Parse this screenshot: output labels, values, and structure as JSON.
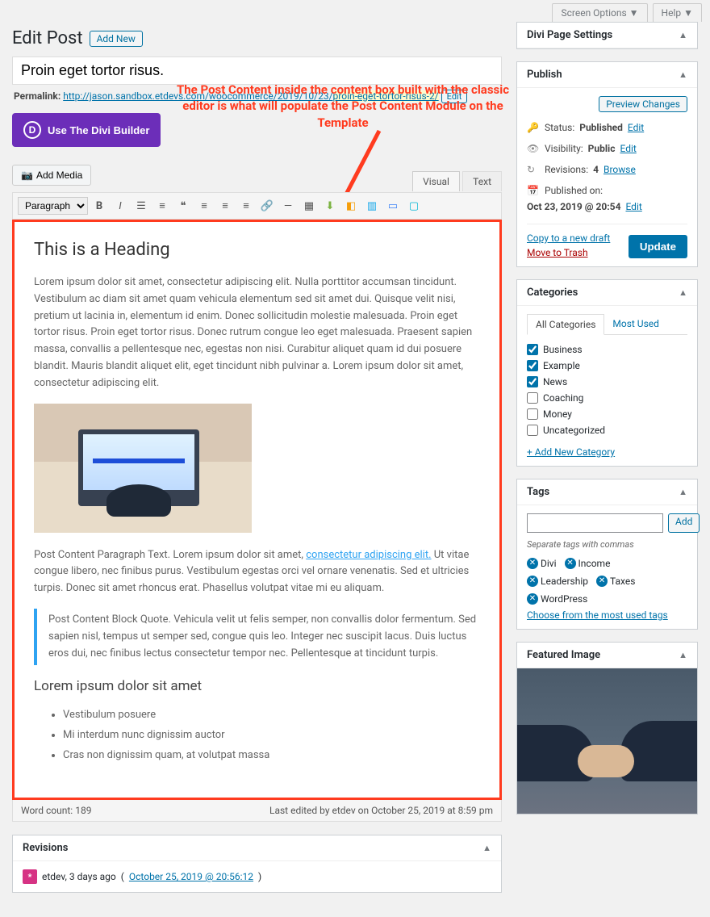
{
  "topbar": {
    "screen_options": "Screen Options",
    "help": "Help"
  },
  "heading": {
    "title": "Edit Post",
    "add_new": "Add New"
  },
  "title_field": {
    "value": "Proin eget tortor risus."
  },
  "permalink": {
    "label": "Permalink:",
    "base": "http://jason.sandbox.etdevs.com/woocommerce/2019/10/23/",
    "slug": "proin-eget-tortor-risus-2/",
    "edit": "Edit"
  },
  "divi_button": "Use The Divi Builder",
  "annotation_text": "The Post Content inside the content box built with the classic editor is what will populate the Post Content Module on the Template",
  "media_button": "Add Media",
  "editor_tabs": {
    "visual": "Visual",
    "text": "Text"
  },
  "toolbar": {
    "format": "Paragraph"
  },
  "post_content": {
    "heading": "This is a Heading",
    "para1": "Lorem ipsum dolor sit amet, consectetur adipiscing elit. Nulla porttitor accumsan tincidunt. Vestibulum ac diam sit amet quam vehicula elementum sed sit amet dui. Quisque velit nisi, pretium ut lacinia in, elementum id enim. Donec sollicitudin molestie malesuada. Proin eget tortor risus. Proin eget tortor risus. Donec rutrum congue leo eget malesuada. Praesent sapien massa, convallis a pellentesque nec, egestas non nisi. Curabitur aliquet quam id dui posuere blandit. Mauris blandit aliquet elit, eget tincidunt nibh pulvinar a. Lorem ipsum dolor sit amet, consectetur adipiscing elit.",
    "para2_before": "Post Content Paragraph Text. Lorem ipsum dolor sit amet, ",
    "para2_link": "consectetur adipiscing elit.",
    "para2_after": " Ut vitae congue libero, nec finibus purus. Vestibulum egestas orci vel ornare venenatis. Sed et ultricies turpis. Donec sit amet rhoncus erat. Phasellus volutpat vitae mi eu aliquam.",
    "quote": "Post Content Block Quote. Vehicula velit ut felis semper, non convallis dolor fermentum. Sed sapien nisl, tempus ut semper sed, congue quis leo. Integer nec suscipit lacus. Duis luctus eros dui, nec finibus lectus consectetur tempor nec. Pellentesque at tincidunt turpis.",
    "subheading": "Lorem ipsum dolor sit amet",
    "bullets": [
      "Vestibulum posuere",
      "Mi interdum nunc dignissim auctor",
      "Cras non dignissim quam, at volutpat massa"
    ]
  },
  "editor_footer": {
    "word_count_label": "Word count:",
    "word_count": "189",
    "last_edited": "Last edited by etdev on October 25, 2019 at 8:59 pm"
  },
  "revisions_box": {
    "title": "Revisions",
    "author": "etdev, 3 days ago",
    "date_link": "October 25, 2019 @ 20:56:12"
  },
  "divi_settings": {
    "title": "Divi Page Settings"
  },
  "publish": {
    "title": "Publish",
    "preview": "Preview Changes",
    "status_label": "Status:",
    "status_value": "Published",
    "status_edit": "Edit",
    "visibility_label": "Visibility:",
    "visibility_value": "Public",
    "visibility_edit": "Edit",
    "revisions_label": "Revisions:",
    "revisions_value": "4",
    "revisions_link": "Browse",
    "published_label": "Published on:",
    "published_value": "Oct 23, 2019 @ 20:54",
    "published_edit": "Edit",
    "copy_link": "Copy to a new draft",
    "trash_link": "Move to Trash",
    "update_button": "Update"
  },
  "categories": {
    "title": "Categories",
    "tabs": {
      "all": "All Categories",
      "most_used": "Most Used"
    },
    "items": [
      {
        "label": "Business",
        "checked": true
      },
      {
        "label": "Example",
        "checked": true
      },
      {
        "label": "News",
        "checked": true
      },
      {
        "label": "Coaching",
        "checked": false
      },
      {
        "label": "Money",
        "checked": false
      },
      {
        "label": "Uncategorized",
        "checked": false
      }
    ],
    "add_link": "+ Add New Category"
  },
  "tags": {
    "title": "Tags",
    "add_button": "Add",
    "separator_note": "Separate tags with commas",
    "items": [
      "Divi",
      "Income",
      "Leadership",
      "Taxes",
      "WordPress"
    ],
    "choose_link": "Choose from the most used tags"
  },
  "featured_image": {
    "title": "Featured Image"
  }
}
